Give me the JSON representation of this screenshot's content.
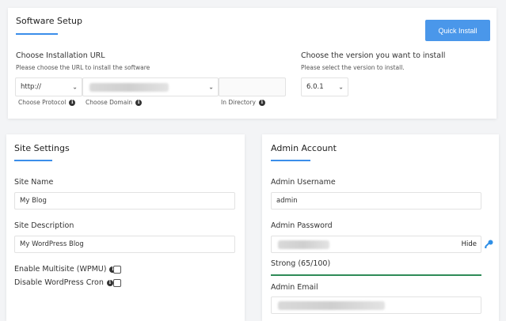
{
  "software_setup": {
    "title": "Software Setup",
    "quick_install_label": "Quick Install",
    "installation_url": {
      "heading": "Choose Installation URL",
      "hint": "Please choose the URL to install the software",
      "protocol_value": "http://",
      "protocol_caption": "Choose Protocol",
      "domain_caption": "Choose Domain",
      "directory_caption": "In Directory",
      "directory_value": ""
    },
    "version": {
      "heading": "Choose the version you want to install",
      "hint": "Please select the version to install.",
      "selected": "6.0.1"
    }
  },
  "site_settings": {
    "title": "Site Settings",
    "site_name_label": "Site Name",
    "site_name_value": "My Blog",
    "site_description_label": "Site Description",
    "site_description_value": "My WordPress Blog",
    "multisite_label": "Enable Multisite (WPMU)",
    "multisite_checked": false,
    "cron_label": "Disable WordPress Cron",
    "cron_checked": false
  },
  "admin_account": {
    "title": "Admin Account",
    "username_label": "Admin Username",
    "username_value": "admin",
    "password_label": "Admin Password",
    "hide_label": "Hide",
    "strength_label": "Strong (65/100)",
    "strength_value": 65,
    "email_label": "Admin Email"
  },
  "colors": {
    "accent": "#3b8eea",
    "button": "#4a97ea",
    "strength": "#2e8b57",
    "key_icon": "#2f8fe6"
  },
  "icons": {
    "info": "info-icon",
    "key": "key-icon",
    "chevron": "chevron-down-icon"
  }
}
